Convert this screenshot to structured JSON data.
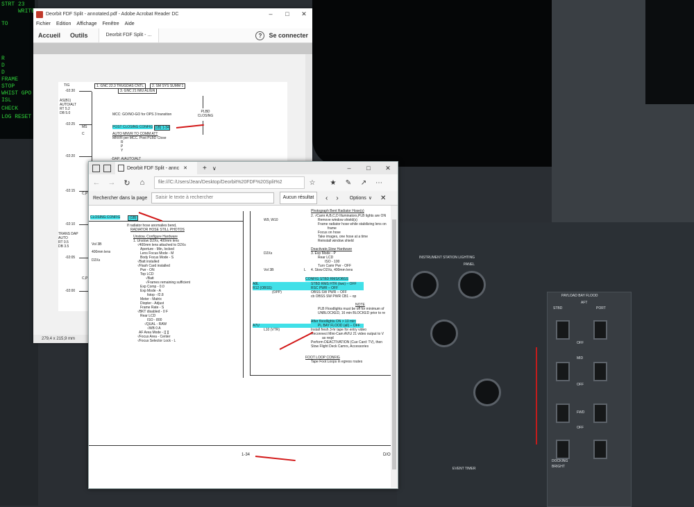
{
  "background": {
    "sim_display_lines": [
      "STRT 23",
      "WRITE 25",
      "TO",
      "R",
      "D",
      "D",
      "FRAME",
      "STOP",
      "WHIST GPO",
      "ISL",
      "CHECK",
      "LOG RESET"
    ],
    "panel_labels": [
      "INSTRUMENT STATION LIGHTING",
      "PANEL",
      "PAYLOAD BAY FLOOD",
      "AFT",
      "FWD",
      "MID",
      "STBD",
      "PORT",
      "OFF",
      "OFF",
      "OFF",
      "DOCKING",
      "BRIGHT",
      "EVENT TIMER"
    ],
    "accent_red": "#c31c1c"
  },
  "acrobat": {
    "title": "Deorbit FDF Split - annotated.pdf - Adobe Acrobat Reader DC",
    "menu": [
      "Fichier",
      "Edition",
      "Affichage",
      "Fenêtre",
      "Aide"
    ],
    "tabs": {
      "home": "Accueil",
      "tools": "Outils",
      "doc": "Deorbit FDF Split - ...",
      "login": "Se connecter"
    },
    "status_size": "279,4 x 215,9 mm",
    "page": {
      "ticks": [
        "-02:30",
        "-02:25",
        "-02:20",
        "-02:15",
        "-02:10",
        "-02:05",
        "-02:00"
      ],
      "left_labels": [
        "TIG",
        "AS(B1)",
        "AUTO/ALT",
        "RT 5.2",
        "DB 5.0",
        "MS",
        "C",
        "C,P",
        "TRANS DAP",
        "AUTO",
        "RT 0.5",
        "DB 3.5",
        "C,P"
      ],
      "top_boxes": [
        "1. GNC 22.3 TRUGDAS CNTL",
        "2. SM SYS SUMM 1",
        "3. GNC 21 IMU ALIGN"
      ],
      "mcc_line": "MCC: GO/NO-GO for OPS 3 transition",
      "post_closing": "POST CLOSING CONFIG",
      "post_closing_ref": "(1B) 1-34",
      "auto_mnvr": "AUTO MNVR TO COMM ATT",
      "mnvr_per_mcc": "MNVR per MCC. Post PLBD Close",
      "ryp": [
        "R",
        "P",
        "Y"
      ],
      "dap": "-DAP: A/AUTO/ALT",
      "plbd": "PLBD CLOSING"
    }
  },
  "edge": {
    "tab_title": "Deorbit FDF Split - annc",
    "url": "file:///C:/Users/Jean/Desktop/Deorbit%20FDF%20Split%2",
    "find": {
      "label": "Rechercher dans la page",
      "placeholder": "Saisir le texte à rechercher",
      "result": "Aucun résultat",
      "options": "Options"
    },
    "page": {
      "closing_config": "CLOSING CONFIG",
      "closing_config_ref": "(1B)",
      "left_col_labels": [
        "Vol 3B",
        "400mm lens",
        "D2Xs"
      ],
      "col1": [
        "If radiator hose anomalies bend,",
        "RADIATOR HOSE STILL PHOTOS",
        "",
        "Unstow, Configure Hardware",
        "1.  Unstow D2Xs, 400mm lens",
        "√400mm lens attached to D2Xs",
        "Aperture - Min, locked",
        "Lens Focus Mode - M",
        "Body Focus Mode - S",
        "√Batt installed",
        "√Flash Card installed",
        "Pwr - ON",
        "Top LCD",
        "√Batt",
        "√Frames remaining sufficient",
        "Exp Comp - 0.0",
        "Exp Mode - A",
        "fstop - f2.8",
        "Meter - Matrix",
        "Diopter - Adjust",
        "Frame Rate - S",
        "√BKT disabled - 0 F",
        "Rear LCD",
        "ISO - 800",
        "√QUAL - RAW",
        "√WB 0 A",
        "AF Area Mode - [[ ]]",
        "√Focus Area - Center",
        "√Focus Selector Lock - L"
      ],
      "right_labels": [
        "W9, W10",
        "D2Xs",
        "Vol 3B",
        "L",
        "A8L",
        "R12 (OBSS)",
        "(OPP)",
        "A7U",
        "L10 (VTR)"
      ],
      "col2": [
        "Photograph Bent Radiator Hose(s)",
        "2. √Camr A,B,C,D Illuminators,PLB lights are ON",
        "Remove window shield(s)",
        "Frame radiator hose while stabilizing lens on",
        "frame",
        "Focus on hose",
        "Take images, one hose at a time",
        "Reinstall window shield",
        "",
        "Deactivate,Stow Hardware",
        "3.  Exp Mode - P",
        "Rear LCD",
        "ISO - 100",
        "Turn Camr Pwr - OFF",
        "4.  Stow D2Xs, 400mm lens"
      ],
      "config_stbd": "CONFIG STBD RMS/OBSS",
      "stbd_rms_htr": "STBD RMS HTR (two) – OFF",
      "rsc_pwr": "RSC PWR – OFF",
      "obss_pwr": "OBSS SW PWR – OFF",
      "obss_cb": "cb OBSS SW PWR CB1 – op",
      "note_label": "NOTE",
      "note1": "PLB Floodlights must be off for minimum of",
      "note2": "UNBLOCKED, 16 min BLOCKED prior to re",
      "after_flood": "After floodlights ON > 10 min:",
      "pl_bay_flood": "PL BAY FLOOD (all) – OFF",
      "col3": [
        "Install fresh 3-hr tape for entry video",
        "Reconnect Mini-Cam AVIU 21 video output to V",
        "as reqd",
        "Perform DEACTIVATION (Cue Card: TV), then",
        "Stow Flight Deck Camrs, Accessories"
      ],
      "foot_loop": "FOOT LOOP CONFIG",
      "foot_loop_item": "Tape Foot Loops in egress routes",
      "page_number": "1-34",
      "page_code": "D/O"
    }
  }
}
